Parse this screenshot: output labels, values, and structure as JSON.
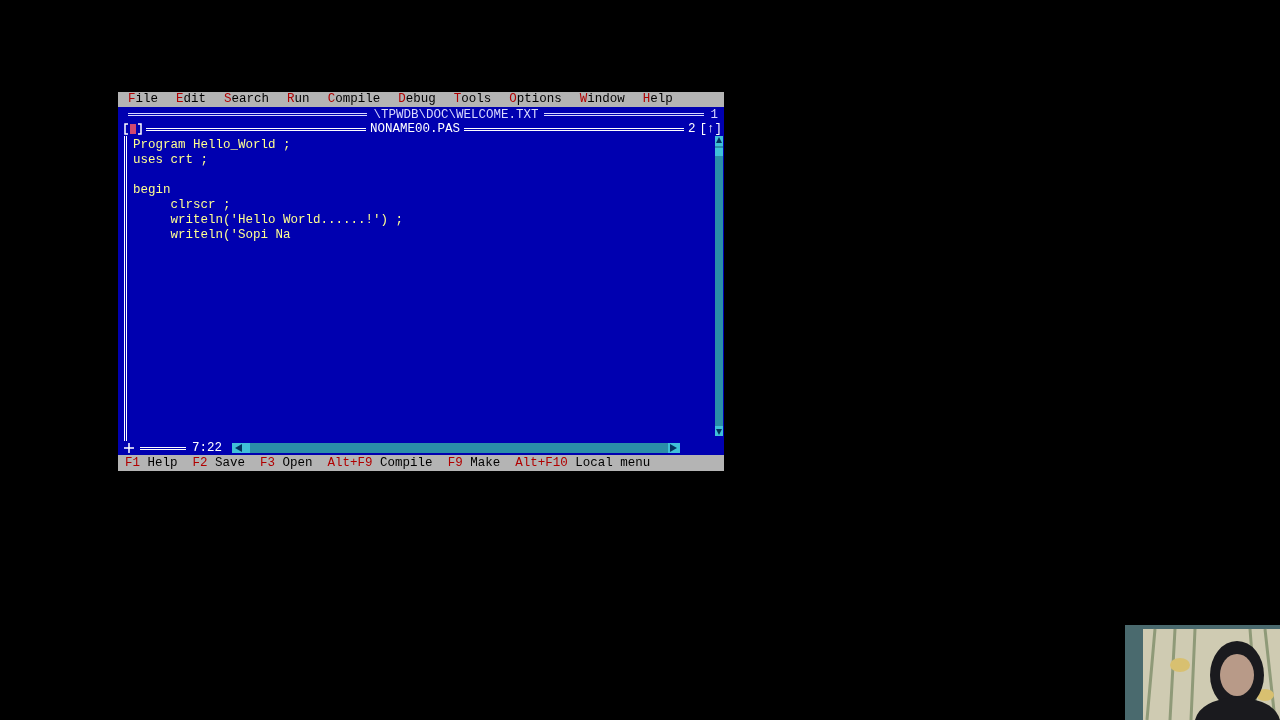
{
  "menu": [
    {
      "label": "File"
    },
    {
      "label": "Edit"
    },
    {
      "label": "Search"
    },
    {
      "label": "Run"
    },
    {
      "label": "Compile"
    },
    {
      "label": "Debug"
    },
    {
      "label": "Tools"
    },
    {
      "label": "Options"
    },
    {
      "label": "Window"
    },
    {
      "label": "Help"
    }
  ],
  "back_window": {
    "title": "\\TPWDB\\DOC\\WELCOME.TXT",
    "number": "1"
  },
  "editor": {
    "title": "NONAME00.PAS",
    "number": "2",
    "zoom_box": "[↑]",
    "cursor_position": "7:22",
    "lines": [
      {
        "kind": "code",
        "text": "Program Hello_World ;"
      },
      {
        "kind": "code",
        "text": "uses crt ;"
      },
      {
        "kind": "blank"
      },
      {
        "kind": "code",
        "text": "begin"
      },
      {
        "kind": "code",
        "text": "     clrscr ;"
      },
      {
        "kind": "code",
        "text": "     writeln('Hello World......!') ;"
      },
      {
        "kind": "code",
        "text": "     writeln('Sopi Na"
      }
    ]
  },
  "status_bar": [
    {
      "key": "F1",
      "label": "Help"
    },
    {
      "key": "F2",
      "label": "Save"
    },
    {
      "key": "F3",
      "label": "Open"
    },
    {
      "key": "Alt+F9",
      "label": "Compile"
    },
    {
      "key": "F9",
      "label": "Make"
    },
    {
      "key": "Alt+F10",
      "label": "Local menu"
    }
  ]
}
